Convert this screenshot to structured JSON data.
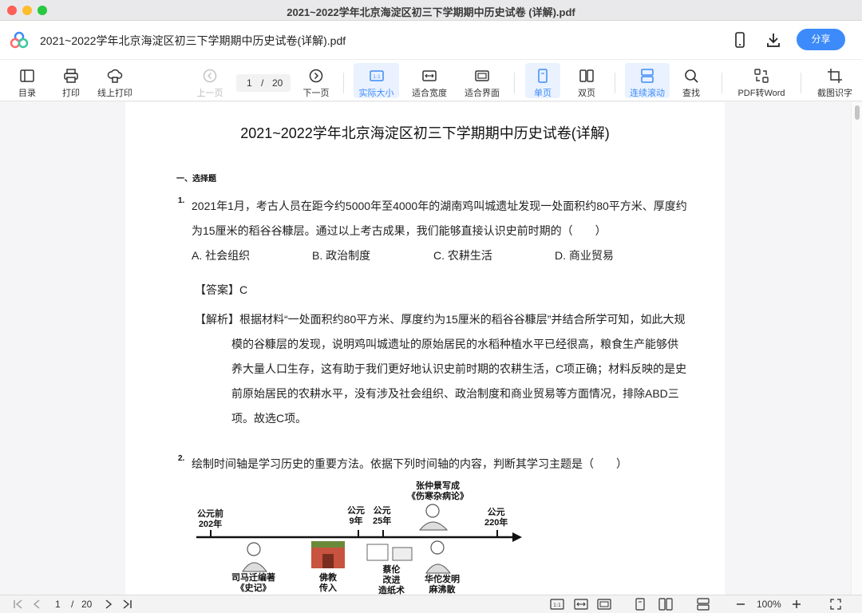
{
  "window": {
    "title": "2021~2022学年北京海淀区初三下学期期中历史试卷 (详解).pdf"
  },
  "header": {
    "doc_title": "2021~2022学年北京海淀区初三下学期期中历史试卷(详解).pdf",
    "share_label": "分享"
  },
  "toolbar": {
    "toc": "目录",
    "print": "打印",
    "online_print": "线上打印",
    "prev": "上一页",
    "current_page": "1",
    "page_sep": "/",
    "total_pages": "20",
    "next": "下一页",
    "actual_size": "实际大小",
    "fit_width": "适合宽度",
    "fit_window": "适合界面",
    "single_page": "单页",
    "double_page": "双页",
    "continuous": "连续滚动",
    "find": "查找",
    "pdf_to_word": "PDF转Word",
    "ocr": "截图识字"
  },
  "document": {
    "title": "2021~2022学年北京海淀区初三下学期期中历史试卷(详解)",
    "section": "一、选择题",
    "q1": {
      "num": "1.",
      "line1": "2021年1月，考古人员在距今约5000年至4000年的湖南鸡叫城遗址发现一处面积约80平方米、厚度约",
      "line2": "为15厘米的稻谷谷糠层。通过以上考古成果，我们能够直接认识史前时期的（　　）",
      "opt_a": "A. 社会组织",
      "opt_b": "B. 政治制度",
      "opt_c": "C. 农耕生活",
      "opt_d": "D. 商业贸易",
      "answer": "【答案】C",
      "exp1": "【解析】根据材料“一处面积约80平方米、厚度约为15厘米的稻谷谷糠层”并结合所学可知，如此大规",
      "exp2": "模的谷糠层的发现，说明鸡叫城遗址的原始居民的水稻种植水平已经很高，粮食生产能够供",
      "exp3": "养大量人口生存，这有助于我们更好地认识史前时期的农耕生活，C项正确；材料反映的是史",
      "exp4": "前原始居民的农耕水平，没有涉及社会组织、政治制度和商业贸易等方面情况，排除ABD三",
      "exp5": "项。故选C项。"
    },
    "q2": {
      "num": "2.",
      "line1": "绘制时间轴是学习历史的重要方法。依据下列时间轴的内容，判断其学习主题是（　　）",
      "timeline": {
        "l1a": "公元前",
        "l1b": "202年",
        "l2a": "公元",
        "l2b": "9年",
        "l3a": "公元",
        "l3b": "25年",
        "l4a": "张仲景写成",
        "l4b": "《伤寒杂病论》",
        "l5a": "公元",
        "l5b": "220年",
        "b1a": "司马迁编著",
        "b1b": "《史记》",
        "b2a": "佛教",
        "b2b": "传入",
        "b3a": "蔡伦",
        "b3b": "改进",
        "b3c": "造纸术",
        "b4a": "华佗发明",
        "b4b": "麻沸散"
      }
    }
  },
  "bottom": {
    "current_page": "1",
    "sep": "/",
    "total_pages": "20",
    "zoom": "100%"
  }
}
